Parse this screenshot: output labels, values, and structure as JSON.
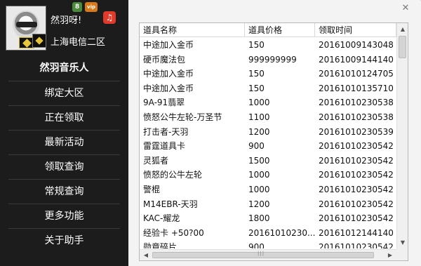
{
  "profile": {
    "nickname": "然羽呀!",
    "server": "上海电信二区",
    "badges": {
      "rank": "8",
      "vip": "vip",
      "music": "♫"
    }
  },
  "menu": [
    {
      "label": "然羽音乐人"
    },
    {
      "label": "绑定大区"
    },
    {
      "label": "正在领取"
    },
    {
      "label": "最新活动"
    },
    {
      "label": "领取查询"
    },
    {
      "label": "常规查询"
    },
    {
      "label": "更多功能"
    },
    {
      "label": "关于助手"
    }
  ],
  "table": {
    "headers": [
      "道具名称",
      "道具价格",
      "领取时间"
    ],
    "rows": [
      [
        "中途加入金币",
        "150",
        "20161009143048"
      ],
      [
        "硬币魔法包",
        "999999999",
        "20161009144140"
      ],
      [
        "中途加入金币",
        "150",
        "20161010124705"
      ],
      [
        "中途加入金币",
        "150",
        "20161010135710"
      ],
      [
        "9A-91翡翠",
        "1000",
        "20161010230538"
      ],
      [
        "愤怒公牛左轮-万圣节",
        "1100",
        "20161010230538"
      ],
      [
        "打击者-天羽",
        "1200",
        "20161010230539"
      ],
      [
        "雷霆道具卡",
        "900",
        "20161010230542"
      ],
      [
        "灵狐者",
        "1500",
        "20161010230542"
      ],
      [
        "愤怒的公牛左轮",
        "1000",
        "20161010230542"
      ],
      [
        "警棍",
        "1000",
        "20161010230542"
      ],
      [
        "M14EBR-天羽",
        "1200",
        "20161010230542"
      ],
      [
        "KAC-耀龙",
        "1800",
        "20161010230542"
      ],
      [
        "经验卡 +50?00",
        "20161010230...",
        "20161012144140"
      ],
      [
        "勋章碎片",
        "900",
        "20161010230542"
      ]
    ]
  },
  "window": {
    "close": "✕"
  },
  "scroll": {
    "up": "▲",
    "down": "▼",
    "left": "◀",
    "right": "▶",
    "grip": "|||"
  },
  "colors": {
    "sidebar_bg": "#1c1c1c",
    "panel_bg": "#ffffff",
    "text_light": "#ffffff"
  }
}
